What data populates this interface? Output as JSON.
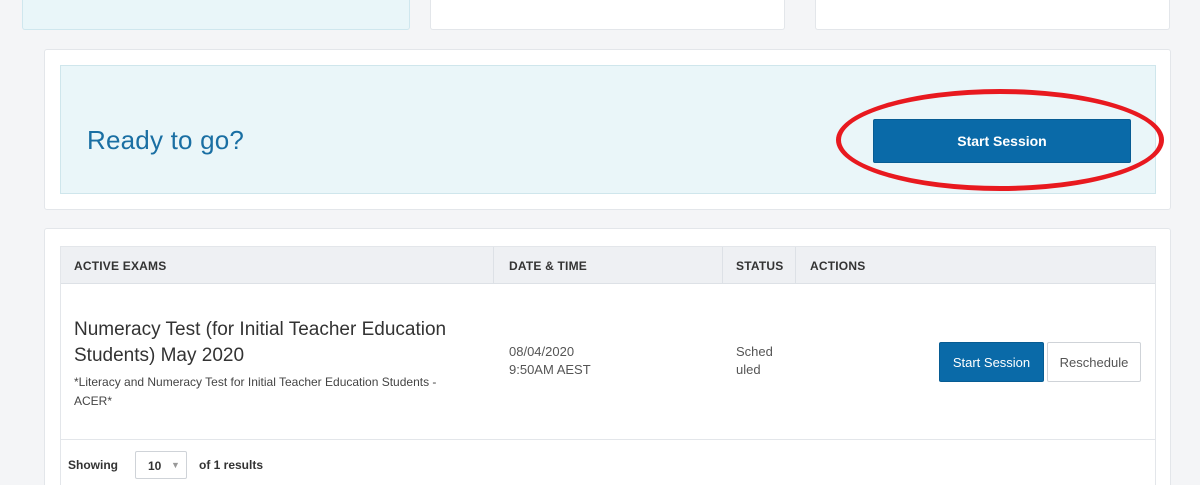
{
  "ready": {
    "title": "Ready to go?",
    "start_button": "Start Session"
  },
  "table": {
    "headers": [
      "ACTIVE EXAMS",
      "DATE & TIME",
      "STATUS",
      "ACTIONS"
    ],
    "rows": [
      {
        "title": "Numeracy Test (for Initial Teacher Education Students) May 2020",
        "subtitle": "*Literacy and Numeracy Test for Initial Teacher Education Students - ACER*",
        "date": "08/04/2020",
        "time": "9:50AM AEST",
        "status_line1": "Sched",
        "status_line2": "uled",
        "start_button": "Start Session",
        "reschedule_button": "Reschedule"
      }
    ]
  },
  "footer": {
    "showing_label": "Showing",
    "page_size": "10",
    "results_text": "of 1 results"
  },
  "icons": {
    "dropdown": "chevron-down-icon"
  },
  "colors": {
    "primary": "#0a6aa8",
    "title_blue": "#1a6fa3",
    "annotation_red": "#e8191f",
    "panel_tint": "#eaf6f9"
  }
}
